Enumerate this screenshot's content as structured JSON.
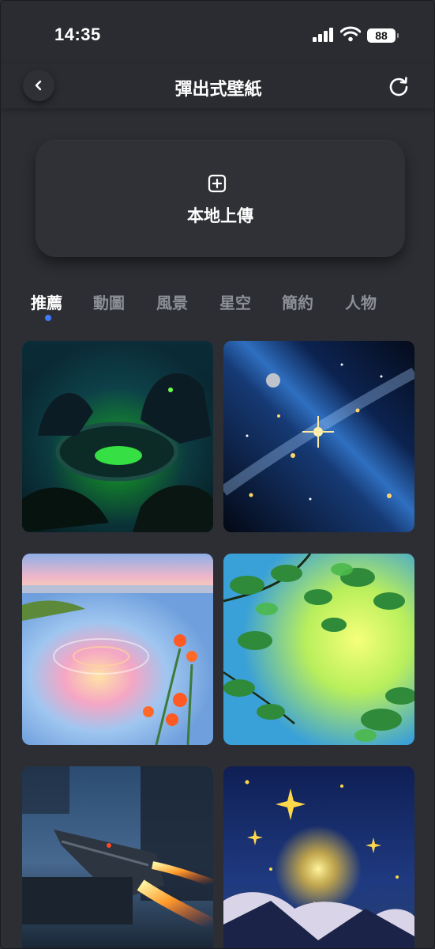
{
  "status_bar": {
    "time": "14:35",
    "battery": "88"
  },
  "header": {
    "title": "彈出式壁紙"
  },
  "upload": {
    "label": "本地上傳"
  },
  "tabs": [
    {
      "label": "推薦",
      "active": true
    },
    {
      "label": "動圖"
    },
    {
      "label": "風景"
    },
    {
      "label": "星空"
    },
    {
      "label": "簡約"
    },
    {
      "label": "人物"
    }
  ],
  "wallpapers": [
    {
      "subject": "dark-fantasy-swamp-dragon"
    },
    {
      "subject": "starry-galaxy"
    },
    {
      "subject": "pastel-lake-ripples-flowers"
    },
    {
      "subject": "green-leaves-sky"
    },
    {
      "subject": "sci-fi-spaceship"
    },
    {
      "subject": "crescent-moon-starry-night"
    }
  ],
  "colors": {
    "background": "#2c2e33",
    "accent": "#3e7bfa",
    "tab_inactive": "#8c8f96"
  }
}
